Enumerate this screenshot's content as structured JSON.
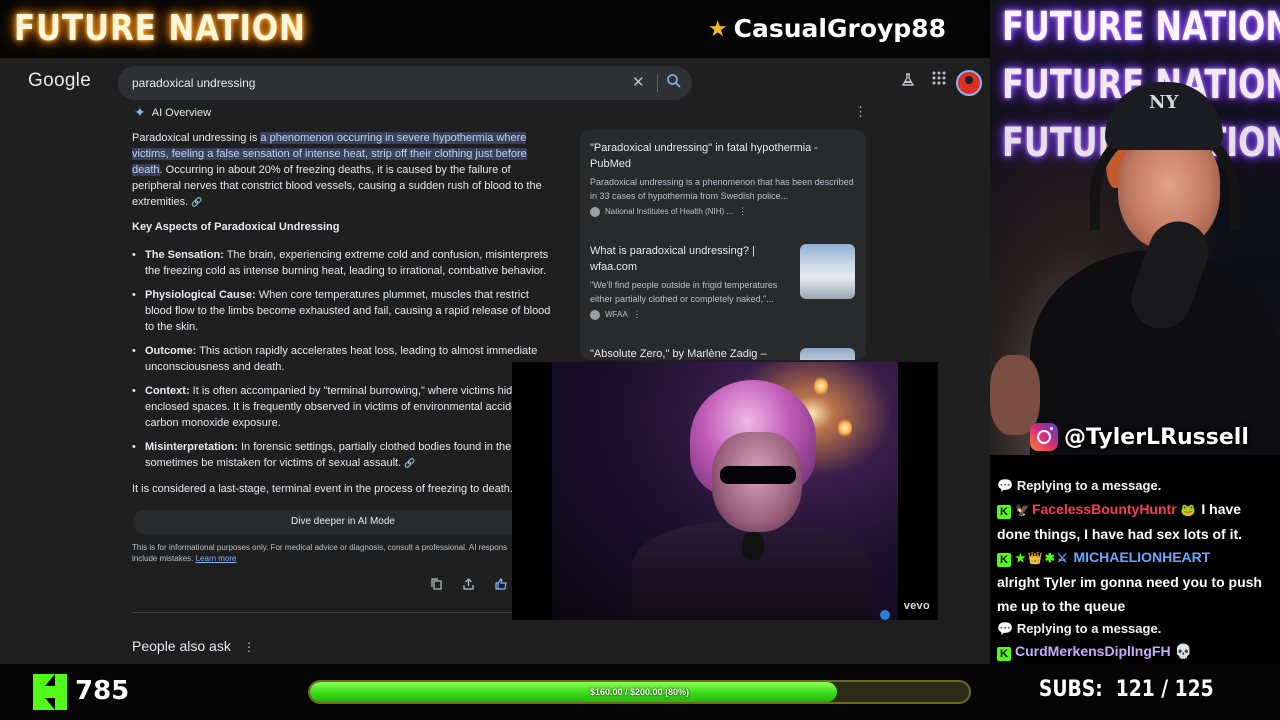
{
  "stream": {
    "brand": "FUTURE NATION",
    "follower_name": "CasualGroyp88",
    "instagram": "@TylerLRussell",
    "kick_count": "785",
    "goal_label": "$160.00 / $200.00 (80%)",
    "goal_progress": 0.8,
    "subs_label": "SUBS:",
    "subs_value": "121 / 125"
  },
  "google": {
    "logo": "Google",
    "search_query": "paradoxical undressing",
    "ai_overview_label": "AI Overview",
    "intro": {
      "lead": "Paradoxical undressing is ",
      "highlight": "a phenomenon occurring in severe hypothermia where victims, feeling a false sensation of intense heat, strip off their clothing just before death",
      "rest": ". Occurring in about 20% of freezing deaths, it is caused by the failure of peripheral nerves that constrict blood vessels, causing a sudden rush of blood to the extremities."
    },
    "key_aspects_heading": "Key Aspects of Paradoxical Undressing",
    "key_aspects": [
      {
        "term": "The Sensation:",
        "text": " The brain, experiencing extreme cold and confusion, misinterprets the freezing cold as intense burning heat, leading to irrational, combative behavior."
      },
      {
        "term": "Physiological Cause:",
        "text": " When core temperatures plummet, muscles that restrict blood flow to the limbs become exhausted and fail, causing a rapid release of blood to the skin."
      },
      {
        "term": "Outcome:",
        "text": " This action rapidly accelerates heat loss, leading to almost immediate unconsciousness and death."
      },
      {
        "term": "Context:",
        "text": " It is often accompanied by \"terminal burrowing,\" where victims hid small, enclosed spaces. It is frequently observed in victims of environmental accidental carbon monoxide exposure."
      },
      {
        "term": "Misinterpretation:",
        "text": " In forensic settings, partially clothed bodies found in the can sometimes be mistaken for victims of sexual assault."
      }
    ],
    "conclusion": "It is considered a last-stage, terminal event in the process of freezing to death.",
    "dive_deeper": "Dive deeper in AI Mode",
    "disclaimer": "This is for informational purposes only. For medical advice or diagnosis, consult a professional. AI respons include mistakes.",
    "learn_more": "Learn more",
    "people_also_ask": "People also ask",
    "sources": [
      {
        "title": "\"Paradoxical undressing\" in fatal hypothermia - PubMed",
        "snippet": "Paradoxical undressing is a phenomenon that has been described in 33 cases of hypothermia from Swedish police...",
        "site": "National Institutes of Health (NIH) ..."
      },
      {
        "title": "What is paradoxical undressing? | wfaa.com",
        "snippet": "\"We'll find people outside in frigid temperatures either partially clothed or completely naked,\"...",
        "site": "WFAA"
      },
      {
        "title": "\"Absolute Zero,\" by Marlène Zadig –"
      }
    ]
  },
  "video": {
    "watermark": "vevo"
  },
  "chat": {
    "lines": [
      {
        "type": "reply",
        "text": "Replying to a message."
      },
      {
        "user": "FacelessBountyHuntr",
        "message": " I have done things, I have had sex lots of it."
      },
      {
        "user": "MICHAELIONHEART",
        "message": "alright Tyler im gonna need you to push me up to the queue"
      },
      {
        "type": "reply",
        "text": "Replying to a message."
      },
      {
        "user": "CurdMerkensDiplIngFH",
        "message": ""
      }
    ]
  },
  "colors": {
    "kick_green": "#53fc18",
    "google_bg": "#1f1f1f",
    "highlight": "#37415a",
    "link": "#8ab4f8"
  },
  "icons": [
    "star-icon",
    "clear-icon",
    "search-icon",
    "labs-icon",
    "apps-icon",
    "sparkle-icon",
    "more-vert-icon",
    "link-icon",
    "copy-icon",
    "share-icon",
    "thumbs-up-icon",
    "instagram-icon",
    "kick-logo-icon",
    "speech-bubble-icon"
  ]
}
